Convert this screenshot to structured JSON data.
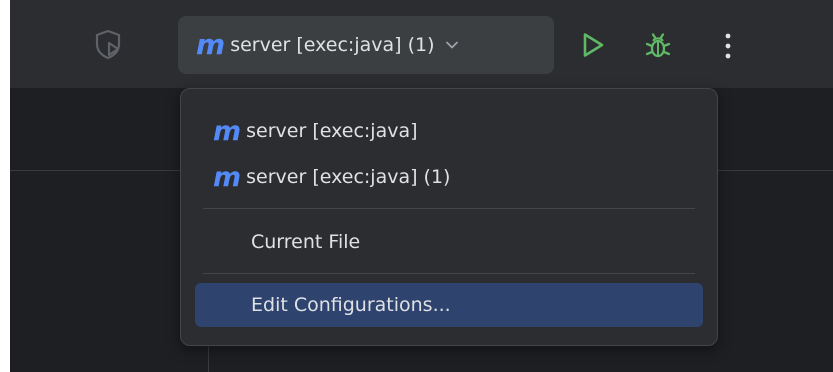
{
  "toolbar": {
    "run_config_label": "server [exec:java] (1)",
    "maven_glyph": "m",
    "icons": {
      "shield": "shield-play-icon",
      "chevron": "chevron-down-icon",
      "run": "run-icon",
      "debug": "debug-bug-icon",
      "more": "more-vertical-icon"
    }
  },
  "dropdown": {
    "items": [
      {
        "label": "server [exec:java]",
        "icon": "maven-icon",
        "glyph": "m"
      },
      {
        "label": "server [exec:java] (1)",
        "icon": "maven-icon",
        "glyph": "m"
      },
      {
        "label": "Current File"
      },
      {
        "label": "Edit Configurations...",
        "selected": true
      }
    ]
  },
  "colors": {
    "toolbar_bg": "#2b2d30",
    "editor_bg": "#1e1f22",
    "maven_blue": "#548af7",
    "run_green": "#5fb865",
    "selection_bg": "#2e436e",
    "text": "#dfe1e5"
  }
}
